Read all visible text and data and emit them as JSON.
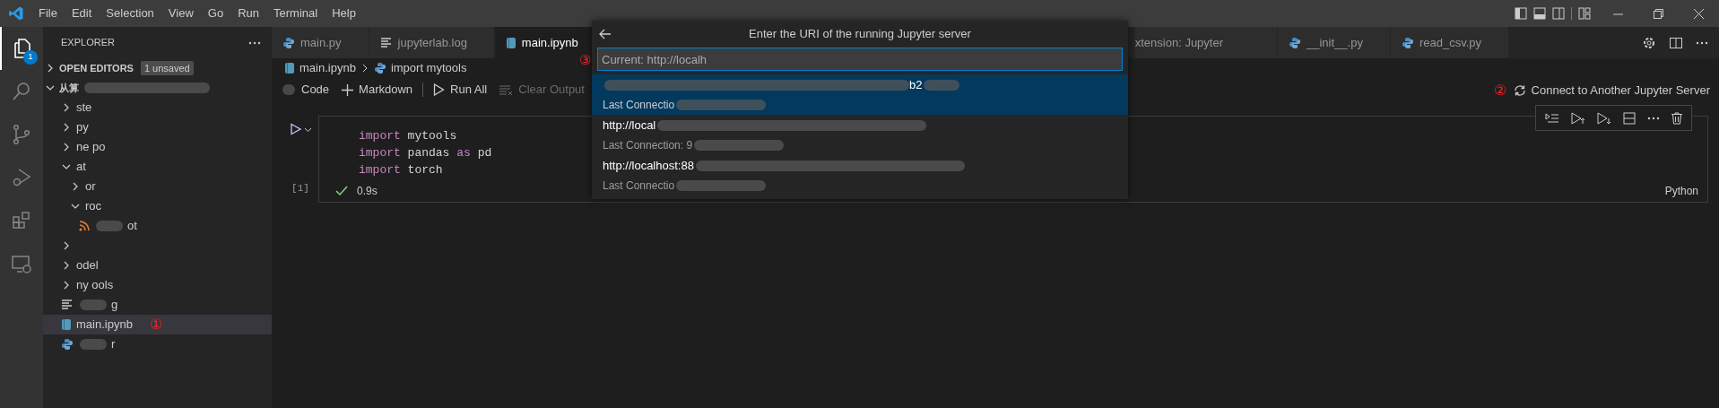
{
  "menu": [
    "File",
    "Edit",
    "Selection",
    "View",
    "Go",
    "Run",
    "Terminal",
    "Help"
  ],
  "activity_bar": [
    {
      "selected": true,
      "badge": "1"
    },
    {
      "selected": false
    },
    {
      "selected": false
    },
    {
      "selected": false
    },
    {
      "selected": false
    },
    {
      "selected": false
    }
  ],
  "sidebar": {
    "title": "EXPLORER",
    "open_editors": {
      "label": "OPEN EDITORS",
      "expanded": false,
      "badge": "1 unsaved"
    },
    "root": {
      "label": "从算",
      "expanded": true,
      "children": [
        {
          "kind": "folder",
          "label": "ste",
          "expanded": false,
          "selected": false
        },
        {
          "kind": "folder",
          "label": "py",
          "expanded": false,
          "selected": false
        },
        {
          "kind": "folder",
          "label": "ne po",
          "expanded": false,
          "selected": false
        },
        {
          "kind": "folder",
          "label": "at",
          "expanded": true,
          "selected": false,
          "children": [
            {
              "kind": "folder",
              "label": "or",
              "expanded": false,
              "selected": false
            },
            {
              "kind": "folder",
              "label": "roc",
              "expanded": true,
              "selected": false,
              "children": [
                {
                  "kind": "rss",
                  "label": "ot",
                  "selected": false
                }
              ]
            }
          ]
        },
        {
          "kind": "folder",
          "expanded": false,
          "selected": false
        },
        {
          "kind": "folder",
          "label": "odel",
          "expanded": false,
          "selected": false
        },
        {
          "kind": "folder",
          "label": "ny ools",
          "expanded": false,
          "selected": false
        },
        {
          "kind": "log",
          "label": "g",
          "selected": false
        },
        {
          "kind": "notebook",
          "label": "main.ipynb",
          "selected": true,
          "annotation": "①"
        },
        {
          "kind": "python",
          "label": "r",
          "selected": false
        }
      ]
    }
  },
  "tabs": [
    {
      "label": "main.py",
      "kind": "python",
      "selected": false
    },
    {
      "label": "jupyterlab.log",
      "kind": "log",
      "selected": false
    },
    {
      "label": "main.ipynb",
      "kind": "notebook",
      "selected": true
    },
    {
      "label": "xtension: Jupyter",
      "kind": "plain",
      "selected": false
    },
    {
      "label": "__init__.py",
      "kind": "python",
      "selected": false
    },
    {
      "label": "read_csv.py",
      "kind": "python",
      "selected": false
    }
  ],
  "breadcrumbs": [
    {
      "label": "main.ipynb",
      "kind": "notebook"
    },
    {
      "label": "import mytools",
      "kind": "python"
    }
  ],
  "notebook_toolbar": [
    {
      "label": "Code",
      "kind": "code",
      "disabled": false
    },
    {
      "label": "Markdown",
      "kind": "add",
      "disabled": false
    },
    {
      "label": "Run All",
      "kind": "run",
      "disabled": false
    },
    {
      "label": "Clear Output",
      "kind": "clear",
      "disabled": true
    }
  ],
  "kernel": {
    "annotation": "②",
    "label": "Connect to Another Jupyter Server"
  },
  "cell": {
    "count": "[1]",
    "lines": [
      [
        {
          "kind": "keyword",
          "text": "import"
        },
        {
          "kind": "plain",
          "text": " mytools"
        }
      ],
      [
        {
          "kind": "keyword",
          "text": "import"
        },
        {
          "kind": "plain",
          "text": " pandas "
        },
        {
          "kind": "keyword",
          "text": "as"
        },
        {
          "kind": "plain",
          "text": " pd"
        }
      ],
      [
        {
          "kind": "keyword",
          "text": "import"
        },
        {
          "kind": "plain",
          "text": " torch"
        }
      ]
    ],
    "success": true,
    "duration": "0.9s",
    "language": "Python"
  },
  "quick_pick": {
    "title": "Enter the URI of the running Jupyter server",
    "annotation": "③",
    "value": "Current: http://localh",
    "items": [
      {
        "label": "b2",
        "detail": "Last Connectio",
        "selected": true
      },
      {
        "label": "http://local",
        "detail": "Last Connection: 9",
        "selected": false
      },
      {
        "label": "http://localhost:88",
        "detail": "Last Connectio",
        "selected": false
      }
    ]
  }
}
